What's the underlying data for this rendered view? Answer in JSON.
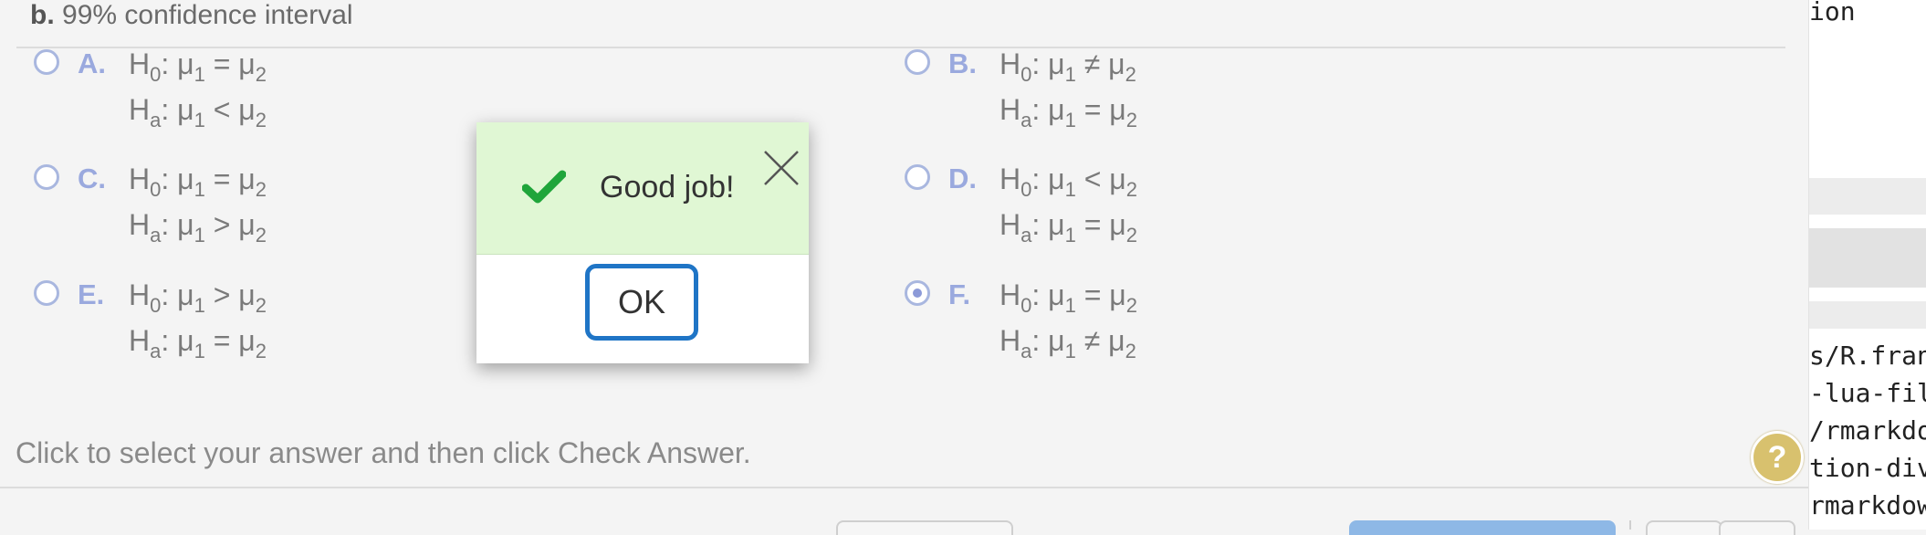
{
  "question": {
    "part_letter": "b.",
    "part_title": "99% confidence interval"
  },
  "options": [
    {
      "letter": "A.",
      "h0": {
        "lhs": "H",
        "lhs_sub": "0",
        "op": "=",
        "mu1": "μ",
        "mu1_sub": "1",
        "mu2": "μ",
        "mu2_sub": "2"
      },
      "ha": {
        "lhs": "H",
        "lhs_sub": "a",
        "op": "<",
        "mu1": "μ",
        "mu1_sub": "1",
        "mu2": "μ",
        "mu2_sub": "2"
      },
      "selected": false
    },
    {
      "letter": "B.",
      "h0": {
        "lhs": "H",
        "lhs_sub": "0",
        "op": "≠",
        "mu1": "μ",
        "mu1_sub": "1",
        "mu2": "μ",
        "mu2_sub": "2"
      },
      "ha": {
        "lhs": "H",
        "lhs_sub": "a",
        "op": "=",
        "mu1": "μ",
        "mu1_sub": "1",
        "mu2": "μ",
        "mu2_sub": "2"
      },
      "selected": false
    },
    {
      "letter": "C.",
      "h0": {
        "lhs": "H",
        "lhs_sub": "0",
        "op": "=",
        "mu1": "μ",
        "mu1_sub": "1",
        "mu2": "μ",
        "mu2_sub": "2"
      },
      "ha": {
        "lhs": "H",
        "lhs_sub": "a",
        "op": ">",
        "mu1": "μ",
        "mu1_sub": "1",
        "mu2": "μ",
        "mu2_sub": "2"
      },
      "selected": false
    },
    {
      "letter": "D.",
      "h0": {
        "lhs": "H",
        "lhs_sub": "0",
        "op": "<",
        "mu1": "μ",
        "mu1_sub": "1",
        "mu2": "μ",
        "mu2_sub": "2"
      },
      "ha": {
        "lhs": "H",
        "lhs_sub": "a",
        "op": "=",
        "mu1": "μ",
        "mu1_sub": "1",
        "mu2": "μ",
        "mu2_sub": "2"
      },
      "selected": false
    },
    {
      "letter": "E.",
      "h0": {
        "lhs": "H",
        "lhs_sub": "0",
        "op": ">",
        "mu1": "μ",
        "mu1_sub": "1",
        "mu2": "μ",
        "mu2_sub": "2"
      },
      "ha": {
        "lhs": "H",
        "lhs_sub": "a",
        "op": "=",
        "mu1": "μ",
        "mu1_sub": "1",
        "mu2": "μ",
        "mu2_sub": "2"
      },
      "selected": false
    },
    {
      "letter": "F.",
      "h0": {
        "lhs": "H",
        "lhs_sub": "0",
        "op": "=",
        "mu1": "μ",
        "mu1_sub": "1",
        "mu2": "μ",
        "mu2_sub": "2"
      },
      "ha": {
        "lhs": "H",
        "lhs_sub": "a",
        "op": "≠",
        "mu1": "μ",
        "mu1_sub": "1",
        "mu2": "μ",
        "mu2_sub": "2"
      },
      "selected": true
    }
  ],
  "instruction": "Click to select your answer and then click Check Answer.",
  "help_button": {
    "label": "?",
    "icon": "question-icon"
  },
  "modal": {
    "message": "Good job!",
    "ok_label": "OK",
    "check_icon": "checkmark-icon",
    "close_icon": "close-icon",
    "accent": "#1f75c6",
    "header_bg": "#e0f7d4"
  },
  "side_panel": {
    "lines": [
      "ion",
      "s/R.fran",
      "-lua-fil",
      "/rmarkdo",
      "tion-div",
      "rmarkdow"
    ]
  },
  "colors": {
    "radio": "#a9b7df",
    "letter": "#9aa9de",
    "check": "#1fa53a"
  }
}
